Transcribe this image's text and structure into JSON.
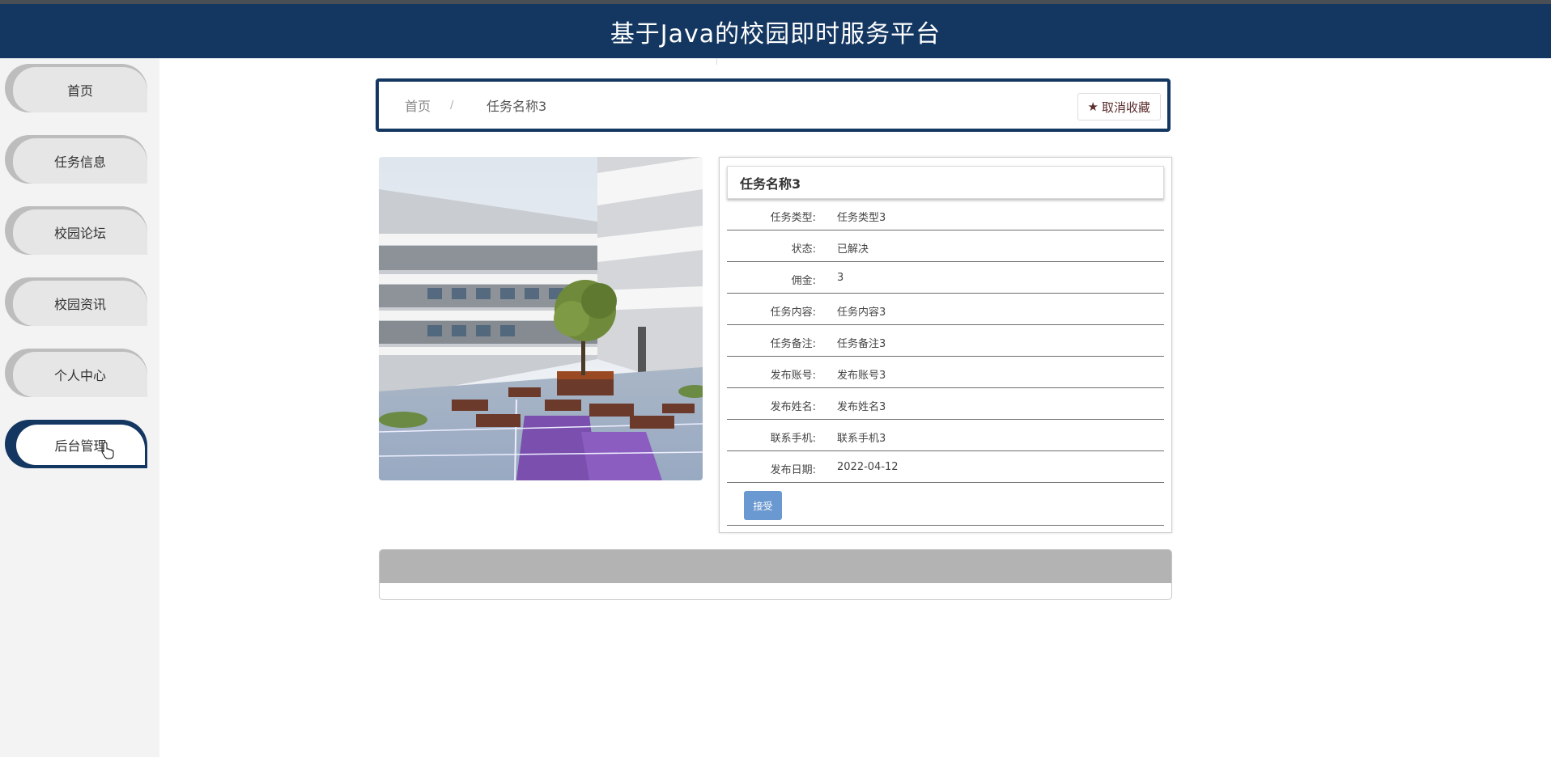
{
  "header": {
    "title": "基于Java的校园即时服务平台"
  },
  "sidebar": {
    "items": [
      {
        "label": "首页"
      },
      {
        "label": "任务信息"
      },
      {
        "label": "校园论坛"
      },
      {
        "label": "校园资讯"
      },
      {
        "label": "个人中心"
      },
      {
        "label": "后台管理"
      }
    ],
    "active_index": 5
  },
  "breadcrumb": {
    "home": "首页",
    "separator": "/",
    "current": "任务名称3"
  },
  "favorite": {
    "icon": "star-icon",
    "label": "取消收藏"
  },
  "photo": {
    "description_icon": "campus-courtyard-photo"
  },
  "detail": {
    "title": "任务名称3",
    "fields": [
      {
        "label": "任务类型:",
        "value": "任务类型3"
      },
      {
        "label": "状态:",
        "value": "已解决"
      },
      {
        "label": "佣金:",
        "value": "3"
      },
      {
        "label": "任务内容:",
        "value": "任务内容3"
      },
      {
        "label": "任务备注:",
        "value": "任务备注3"
      },
      {
        "label": "发布账号:",
        "value": "发布账号3"
      },
      {
        "label": "发布姓名:",
        "value": "发布姓名3"
      },
      {
        "label": "联系手机:",
        "value": "联系手机3"
      },
      {
        "label": "发布日期:",
        "value": "2022-04-12"
      }
    ],
    "accept_label": "接受"
  },
  "colors": {
    "header_bg": "#143761",
    "accent": "#143761",
    "button": "#6a98d0"
  }
}
